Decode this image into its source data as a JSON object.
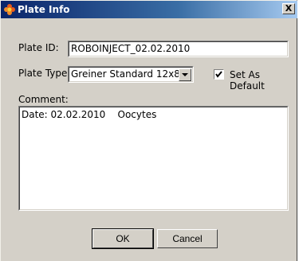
{
  "window": {
    "title": "Plate Info",
    "close_label": "X"
  },
  "form": {
    "plate_id_label": "Plate ID:",
    "plate_id_value": "ROBOINJECT_02.02.2010",
    "plate_type_label": "Plate Type:",
    "plate_type_value": "Greiner Standard 12x8",
    "set_default_label": "Set As Default",
    "set_default_checked": true,
    "comment_label": "Comment:",
    "comment_value": "Date: 02.02.2010    Oocytes"
  },
  "buttons": {
    "ok_label": "OK",
    "cancel_label": "Cancel"
  },
  "icons": {
    "app": "flower-icon",
    "close": "close-icon",
    "dropdown": "chevron-down-icon",
    "check": "checkmark-icon"
  }
}
